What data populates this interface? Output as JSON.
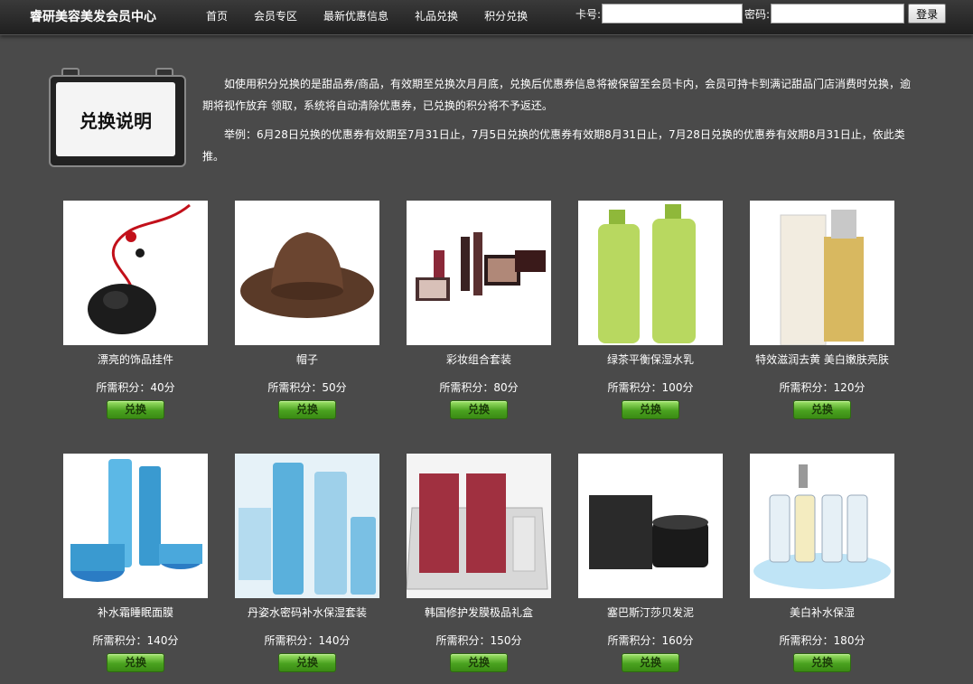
{
  "header": {
    "brand": "睿研美容美发会员中心",
    "nav": [
      "首页",
      "会员专区",
      "最新优惠信息",
      "礼品兑换",
      "积分兑换"
    ],
    "card_label": "卡号:",
    "password_label": "密码:",
    "login_button": "登录"
  },
  "explanation": {
    "badge": "兑换说明",
    "paragraph": "如使用积分兑换的是甜品券/商品，有效期至兑换次月月底，兑换后优惠券信息将被保留至会员卡内，会员可持卡到满记甜品门店消费时兑换，逾期将视作放弃 领取，系统将自动清除优惠券，已兑换的积分将不予返还。",
    "example": "举例：6月28日兑换的优惠券有效期至7月31日止，7月5日兑换的优惠券有效期8月31日止，7月28日兑换的优惠券有效期8月31日止，依此类推。"
  },
  "products": [
    {
      "name": "漂亮的饰品挂件",
      "points": "所需积分：40分",
      "button": "兑换",
      "icon": "jade-pendant-icon"
    },
    {
      "name": "帽子",
      "points": "所需积分：50分",
      "button": "兑换",
      "icon": "cowboy-hat-icon"
    },
    {
      "name": "彩妆组合套装",
      "points": "所需积分：80分",
      "button": "兑换",
      "icon": "makeup-set-icon"
    },
    {
      "name": "绿茶平衡保湿水乳",
      "points": "所需积分：100分",
      "button": "兑换",
      "icon": "green-bottles-icon"
    },
    {
      "name": "特效滋润去黄 美白嫩肤亮肤",
      "points": "所需积分：120分",
      "button": "兑换",
      "icon": "serum-box-icon"
    },
    {
      "name": "补水霜睡眠面膜",
      "points": "所需积分：140分",
      "button": "兑换",
      "icon": "blue-cream-set-icon"
    },
    {
      "name": "丹姿水密码补水保湿套装",
      "points": "所需积分：140分",
      "button": "兑换",
      "icon": "blue-toner-set-icon"
    },
    {
      "name": "韩国修护发膜极品礼盒",
      "points": "所需积分：150分",
      "button": "兑换",
      "icon": "hair-mask-box-icon"
    },
    {
      "name": "塞巴斯汀莎贝发泥",
      "points": "所需积分：160分",
      "button": "兑换",
      "icon": "hair-clay-icon"
    },
    {
      "name": "美白补水保湿",
      "points": "所需积分：180分",
      "button": "兑换",
      "icon": "ampoule-splash-icon"
    }
  ]
}
